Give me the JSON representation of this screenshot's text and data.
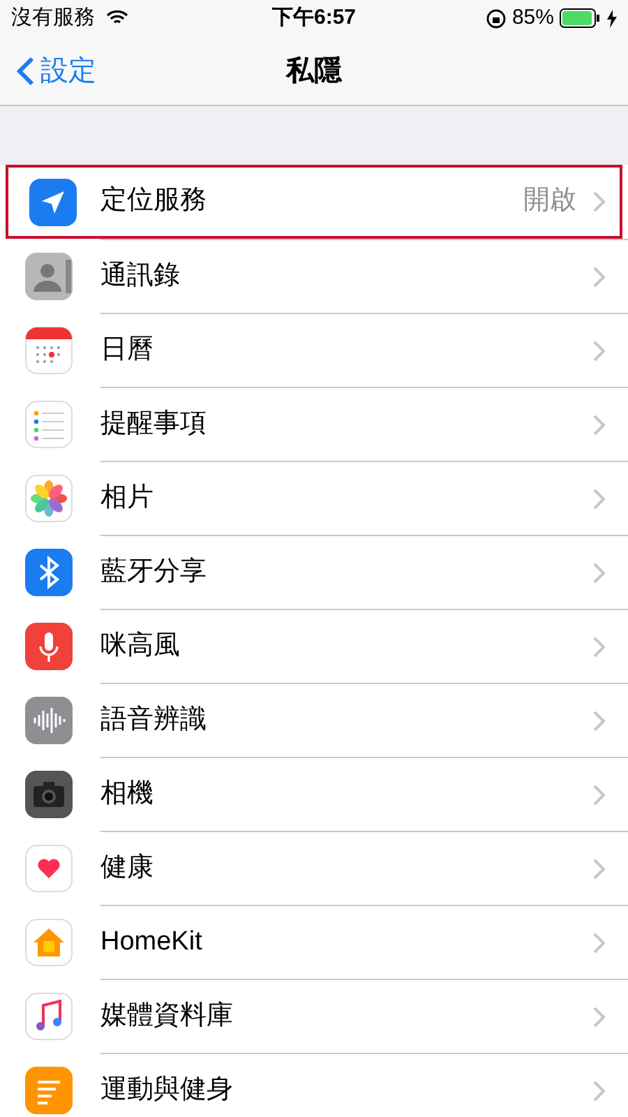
{
  "status_bar": {
    "carrier": "沒有服務",
    "time": "下午6:57",
    "battery": "85%"
  },
  "nav_bar": {
    "back": "設定",
    "title": "私隱"
  },
  "rows": [
    {
      "label": "定位服務",
      "value": "開啟",
      "highlighted": true
    },
    {
      "label": "通訊錄",
      "highlighted": false
    },
    {
      "label": "日曆",
      "highlighted": false
    },
    {
      "label": "提醒事項",
      "highlighted": false
    },
    {
      "label": "相片",
      "highlighted": false
    },
    {
      "label": "藍牙分享",
      "highlighted": false
    },
    {
      "label": "咪高風",
      "highlighted": false
    },
    {
      "label": "語音辨識",
      "highlighted": false
    },
    {
      "label": "相機",
      "highlighted": false
    },
    {
      "label": "健康",
      "highlighted": false
    },
    {
      "label": "HomeKit",
      "highlighted": false
    },
    {
      "label": "媒體資料庫",
      "highlighted": false
    },
    {
      "label": "運動與健身",
      "highlighted": false
    }
  ]
}
